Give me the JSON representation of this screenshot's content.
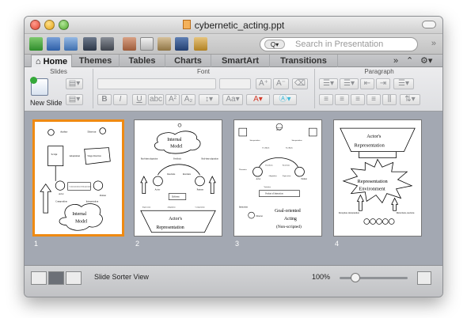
{
  "window": {
    "title": "cybernetic_acting.ppt"
  },
  "search": {
    "placeholder": "Search in Presentation"
  },
  "tabs": [
    "Home",
    "Themes",
    "Tables",
    "Charts",
    "SmartArt",
    "Transitions"
  ],
  "ribbon": {
    "groups": {
      "slides": "Slides",
      "font": "Font",
      "paragraph": "Paragraph"
    },
    "new_slide": "New Slide"
  },
  "slides": [
    {
      "number": "1",
      "labels": [
        "Author",
        "Director",
        "Script",
        "Adaptation",
        "Stage direction",
        "Actor",
        "Partner",
        "Communication & Interpretation",
        "Composition",
        "Interpretation",
        "Internal",
        "Model"
      ]
    },
    {
      "number": "2",
      "labels": [
        "Internal",
        "Model",
        "Real-time adaptation",
        "Feedback",
        "Real-time adaptation",
        "Reactions",
        "Reactions",
        "Actor",
        "Partner",
        "Delivery",
        "Expression",
        "Adaptation",
        "Composition",
        "Actor's",
        "Representation"
      ]
    },
    {
      "number": "3",
      "labels": [
        "Internal",
        "Model",
        "Interpretation",
        "Interpretation",
        "Feedback",
        "Feedback",
        "Reactions",
        "Reactions",
        "Actor",
        "Partner",
        "Thematics",
        "Adaptation",
        "Expression",
        "Variation",
        "Product of Interaction",
        "Instruction",
        "Director",
        "Goal-oriented",
        "Acting",
        "(Non-scripted)"
      ]
    },
    {
      "number": "4",
      "labels": [
        "Actor's",
        "Representation",
        "Representation",
        "Environment",
        "Perception, interpretation",
        "Distractions, reactions"
      ]
    }
  ],
  "statusbar": {
    "view": "Slide Sorter View",
    "zoom": "100%"
  }
}
